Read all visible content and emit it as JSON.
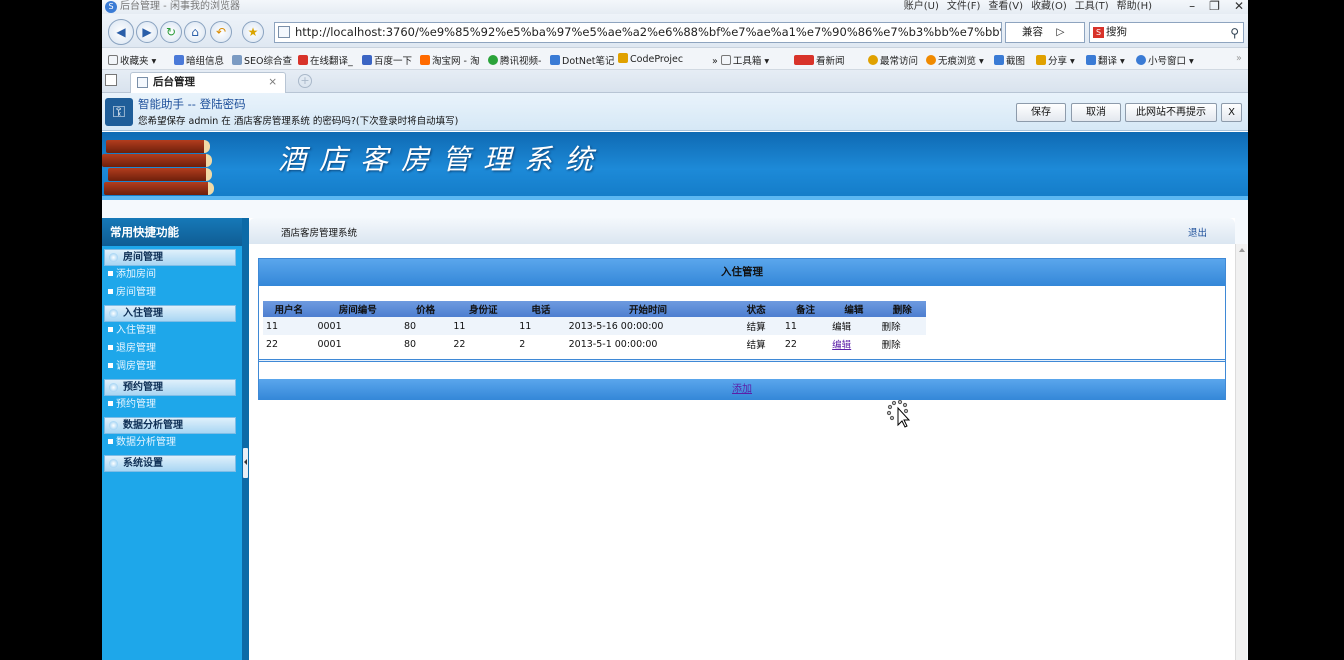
{
  "browser": {
    "window_title": "后台管理 - 闲事我的浏览器",
    "menus": [
      "账户(U)",
      "文件(F)",
      "查看(V)",
      "收藏(O)",
      "工具(T)",
      "帮助(H)"
    ],
    "url": "http://localhost:3760/%e9%85%92%e5%ba%97%e5%ae%a2%e6%88%bf%e7%ae%a1%e7%90%86%e7%b3%bb%e7%bb%9f",
    "compat_label": "兼容",
    "search_value": "搜狗",
    "bookmarks": [
      "收藏夹",
      "暗组信息",
      "SEO综合查",
      "在线翻译_",
      "百度一下",
      "淘宝网 - 淘",
      "腾讯视频-",
      "DotNet笔记",
      "CodeProjec",
      "工具箱",
      "看新闻",
      "最常访问",
      "无痕浏览",
      "截图",
      "分享",
      "翻译",
      "小号窗口"
    ],
    "tab_title": "后台管理"
  },
  "password_bar": {
    "title": "智能助手 -- 登陆密码",
    "message": "您希望保存 admin 在 酒店客房管理系统 的密码吗?(下次登录时将自动填写)",
    "save_label": "保存",
    "cancel_label": "取消",
    "never_label": "此网站不再提示",
    "close_label": "X"
  },
  "banner": {
    "title": "酒店客房管理系统"
  },
  "sidebar": {
    "header": "常用快捷功能",
    "groups": [
      {
        "label": "房间管理",
        "items": [
          "添加房间",
          "房间管理"
        ]
      },
      {
        "label": "入住管理",
        "items": [
          "入住管理",
          "退房管理",
          "调房管理"
        ]
      },
      {
        "label": "预约管理",
        "items": [
          "预约管理"
        ]
      },
      {
        "label": "数据分析管理",
        "items": [
          "数据分析管理"
        ]
      },
      {
        "label": "系统设置",
        "items": []
      }
    ]
  },
  "header": {
    "system_name": "酒店客房管理系统",
    "logout_label": "退出"
  },
  "panel": {
    "title": "入住管理",
    "add_label": "添加",
    "columns": [
      "用户名",
      "房间编号",
      "价格",
      "身份证",
      "电话",
      "开始时间",
      "状态",
      "备注",
      "编辑",
      "删除"
    ],
    "rows": [
      {
        "username": "11",
        "room_no": "0001",
        "price": "80",
        "id_card": "11",
        "phone": "11",
        "start_time": "2013-5-16 00:00:00",
        "status": "结算",
        "remark": "11",
        "edit": "编辑",
        "delete": "删除"
      },
      {
        "username": "22",
        "room_no": "0001",
        "price": "80",
        "id_card": "22",
        "phone": "2",
        "start_time": "2013-5-1 00:00:00",
        "status": "结算",
        "remark": "22",
        "edit": "编辑",
        "delete": "删除"
      }
    ]
  },
  "colors": {
    "banner_blue": "#1d8ad8",
    "sidebar_blue": "#1ea7ea",
    "panel_header_blue": "#3487d8",
    "link_purple": "#5b1fa8"
  }
}
